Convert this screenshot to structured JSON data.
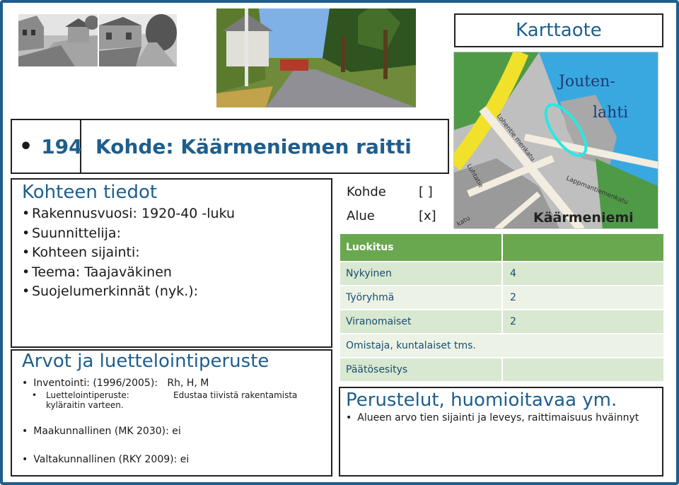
{
  "title": "Karttaote",
  "header": {
    "number": "194",
    "name": "Kohde: Käärmeniemen raitti"
  },
  "map": {
    "water_label_1": "Jouten-",
    "water_label_2": "lahti",
    "place_label": "Käärmeniemi",
    "road_1": "Lohentie menkatu",
    "road_2": "Luhtatie",
    "road_3": "Lappmantiemenkatu",
    "road_4": "katu"
  },
  "kohteen_tiedot": {
    "heading": "Kohteen tiedot",
    "items": [
      "Rakennusvuosi: 1920-40 -luku",
      "Suunnittelija:",
      "Kohteen sijainti:",
      "Teema: Taajaväkinen",
      "Suojelumerkinnät (nyk.):"
    ]
  },
  "scope": {
    "kohde_label": "Kohde",
    "kohde_value": "[ ]",
    "alue_label": "Alue",
    "alue_value": "[x]"
  },
  "luokitus": {
    "header": "Luokitus",
    "rows": [
      {
        "label": "Nykyinen",
        "value": "4"
      },
      {
        "label": "Työryhmä",
        "value": "2"
      },
      {
        "label": "Viranomaiset",
        "value": "2"
      },
      {
        "label": "Omistaja, kuntalaiset tms.",
        "value": ""
      },
      {
        "label": "Päätösesitys",
        "value": ""
      }
    ]
  },
  "arvot": {
    "heading": "Arvot ja luettelointiperuste",
    "inventointi": "Inventointi: (1996/2005):   Rh, H, M",
    "peruste_label": "Luettelointiperuste:",
    "peruste_text": "Edustaa tiivistä rakentamista",
    "peruste_cont": "kyläraitin varteen.",
    "mk": "Maakunnallinen (MK 2030): ei",
    "rky": "Valtakunnallinen (RKY 2009): ei"
  },
  "perustelut": {
    "heading": "Perustelut, huomioitavaa ym.",
    "item": "Alueen arvo tien sijainti ja leveys, raittimaisuus hväinnyt"
  }
}
